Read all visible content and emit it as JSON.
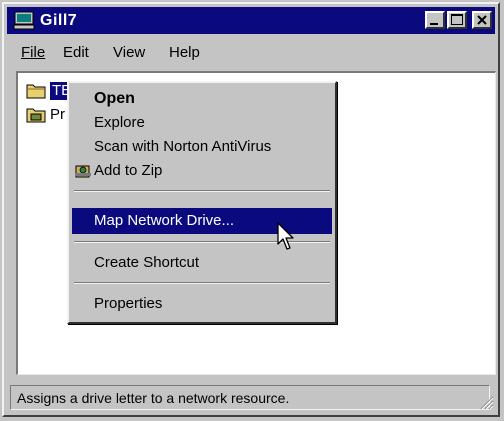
{
  "window": {
    "title": "Gill7",
    "menus": [
      "File",
      "Edit",
      "View",
      "Help"
    ]
  },
  "files": [
    {
      "name": "TE",
      "icon": "folder-icon",
      "selected": true
    },
    {
      "name": "Pr",
      "icon": "printer-folder-icon",
      "selected": false
    }
  ],
  "context_menu": {
    "items": [
      {
        "label": "Open",
        "bold": true
      },
      {
        "label": "Explore"
      },
      {
        "label": "Scan with Norton AntiVirus"
      },
      {
        "label": "Add to Zip",
        "icon": "zip-icon"
      },
      {
        "label": "Map Network Drive...",
        "highlighted": true
      },
      {
        "label": "Create Shortcut"
      },
      {
        "label": "Properties"
      }
    ]
  },
  "status": {
    "text": "Assigns a drive letter to a network resource."
  },
  "colors": {
    "titlebar": "#0a0a7e",
    "face": "#c4c4c4",
    "highlight": "#0a0a7e"
  }
}
